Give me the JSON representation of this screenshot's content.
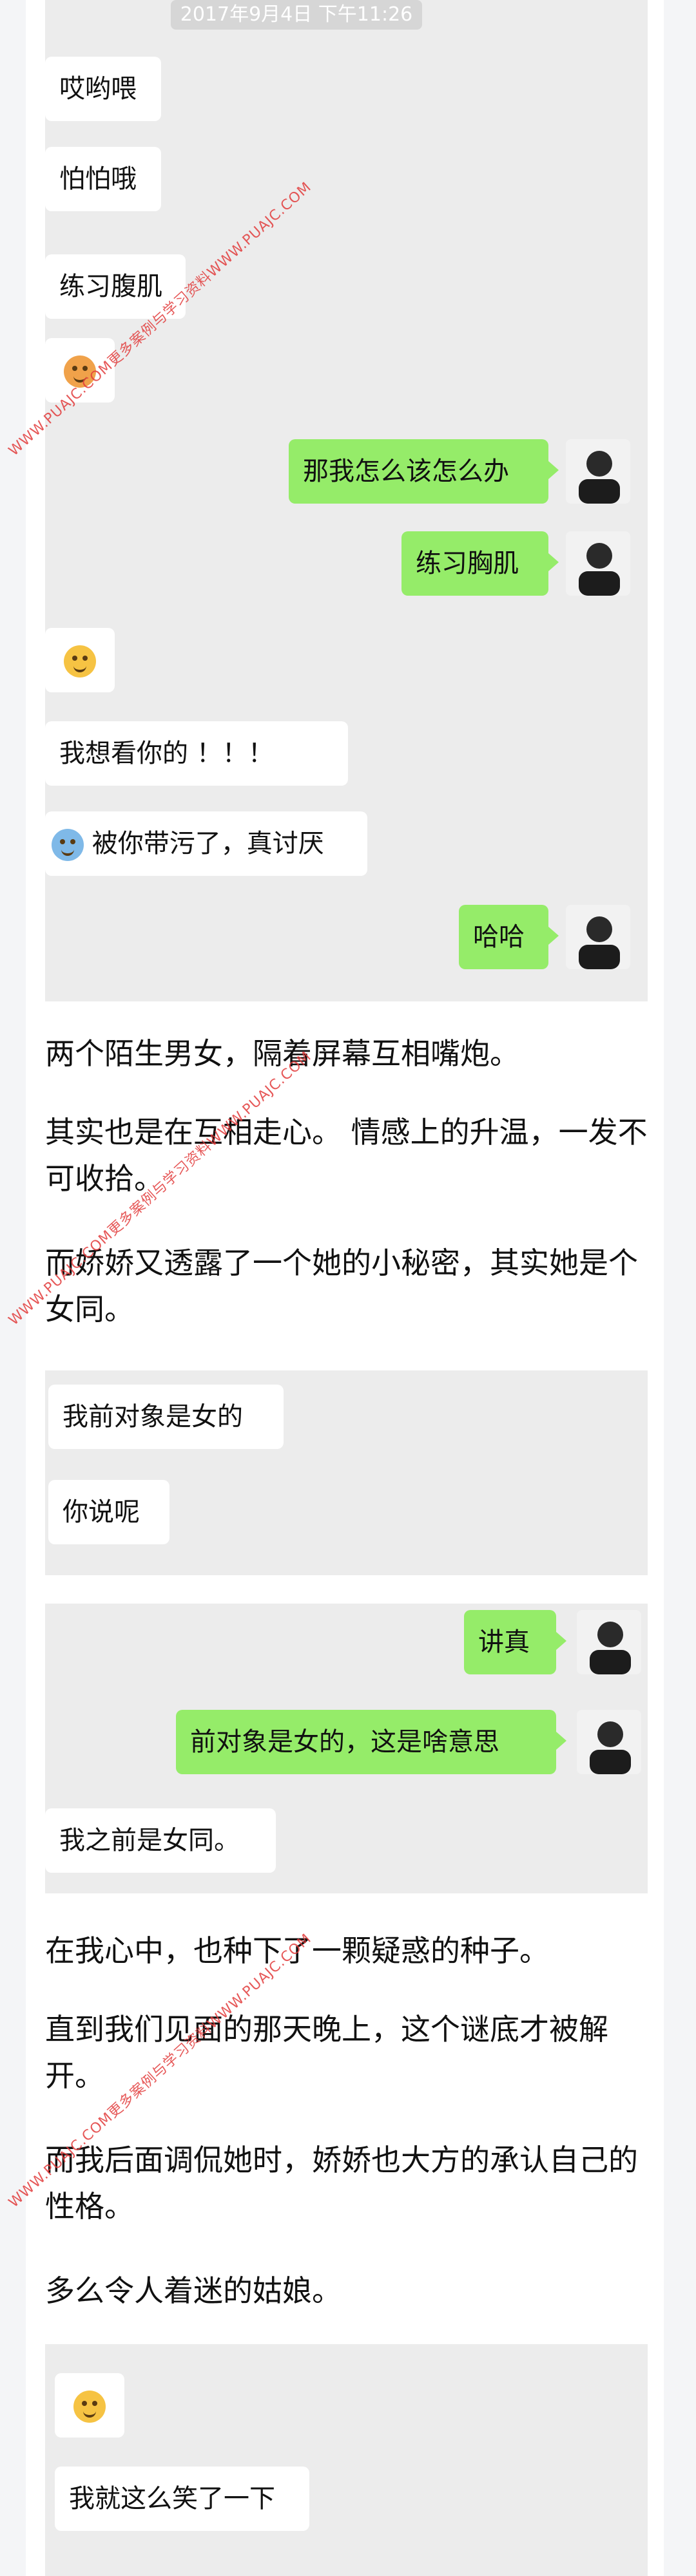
{
  "chat1": {
    "timestamp": "2017年9月4日 下午11:26",
    "messages": [
      {
        "side": "left",
        "text": "哎哟喂"
      },
      {
        "side": "left",
        "text": "怕怕哦"
      }
    ]
  },
  "chat2": {
    "messages": [
      {
        "side": "left",
        "text": "练习腹肌"
      },
      {
        "side": "left",
        "text": "",
        "emoji": "blush-emoji"
      },
      {
        "side": "right",
        "text": "那我怎么该怎么办"
      },
      {
        "side": "right",
        "text": "练习胸肌"
      },
      {
        "side": "left",
        "text": "",
        "emoji": "smirk-emoji"
      },
      {
        "side": "left",
        "text": "我想看你的        ！！！"
      },
      {
        "side": "left",
        "text": "被你带污了，真讨厌",
        "emoji": "cry-emoji"
      },
      {
        "side": "right",
        "text": "哈哈"
      }
    ]
  },
  "paragraphs1": [
    "两个陌生男女，隔着屏幕互相嘴炮。",
    "其实也是在互相走心。 情感上的升温，一发不可收拾。",
    "而娇娇又透露了一个她的小秘密，其实她是个女同。"
  ],
  "chat3": {
    "messages": [
      {
        "side": "left",
        "text": "我前对象是女的"
      },
      {
        "side": "left",
        "text": "你说呢"
      }
    ]
  },
  "chat4": {
    "messages": [
      {
        "side": "right",
        "text": "讲真"
      },
      {
        "side": "right",
        "text": "前对象是女的，这是啥意思"
      },
      {
        "side": "left",
        "text": "我之前是女同。"
      }
    ]
  },
  "paragraphs2": [
    "在我心中，也种下了一颗疑惑的种子。",
    " 直到我们见面的那天晚上，这个谜底才被解开。",
    "而我后面调侃她时，娇娇也大方的承认自己的性格。",
    "多么令人着迷的姑娘。"
  ],
  "chat5": {
    "messages": [
      {
        "side": "left",
        "text": "",
        "emoji": "smirk-emoji"
      },
      {
        "side": "left",
        "text": "我就这么笑了一下"
      }
    ]
  },
  "watermark": "WWW.PUAJC.COM更多案例与学习资料WWW.PUAJC.COM"
}
